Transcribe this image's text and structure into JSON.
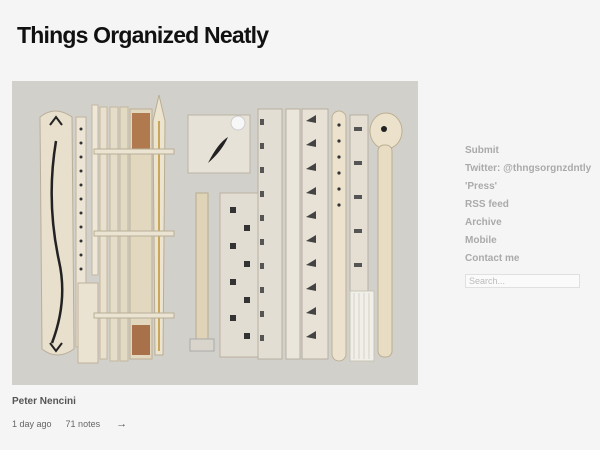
{
  "site": {
    "title": "Things Organized Neatly"
  },
  "post": {
    "caption": "Peter Nencini",
    "age": "1 day ago",
    "notes": "71 notes",
    "permalink_glyph": "→"
  },
  "sidebar": {
    "links": [
      {
        "label": "Submit"
      },
      {
        "label": "Twitter: @thngsorgnzdntly"
      },
      {
        "label": "'Press'"
      },
      {
        "label": "RSS feed"
      },
      {
        "label": "Archive"
      },
      {
        "label": "Mobile"
      },
      {
        "label": "Contact me"
      }
    ],
    "search_placeholder": "Search..."
  },
  "colors": {
    "background": "#f5f5f5",
    "title": "#111111",
    "sidebar_link": "#aaaaaa"
  }
}
